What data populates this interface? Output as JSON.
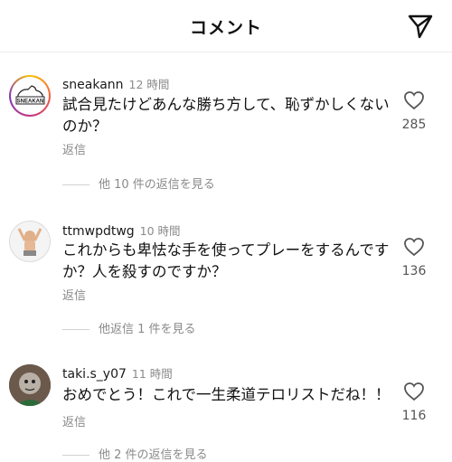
{
  "header": {
    "title": "コメント"
  },
  "comments": [
    {
      "username": "sneakann",
      "time": "12 時間",
      "text": "試合見たけどあんな勝ち方して、恥ずかしくないのか？",
      "reply": "返信",
      "likes": "285",
      "avatar_text": "SNEAKAN",
      "more": "他 10 件の返信を見る"
    },
    {
      "username": "ttmwpdtwg",
      "time": "10 時間",
      "text": "これからも卑怯な手を使ってプレーをするんですか？人を殺すのですか？",
      "reply": "返信",
      "likes": "136",
      "more": "他返信 1 件を見る"
    },
    {
      "username": "taki.s_y07",
      "time": "11 時間",
      "text": "おめでとう！これで一生柔道テロリストだね！！",
      "reply": "返信",
      "likes": "116",
      "more": "他 2 件の返信を見る"
    }
  ]
}
